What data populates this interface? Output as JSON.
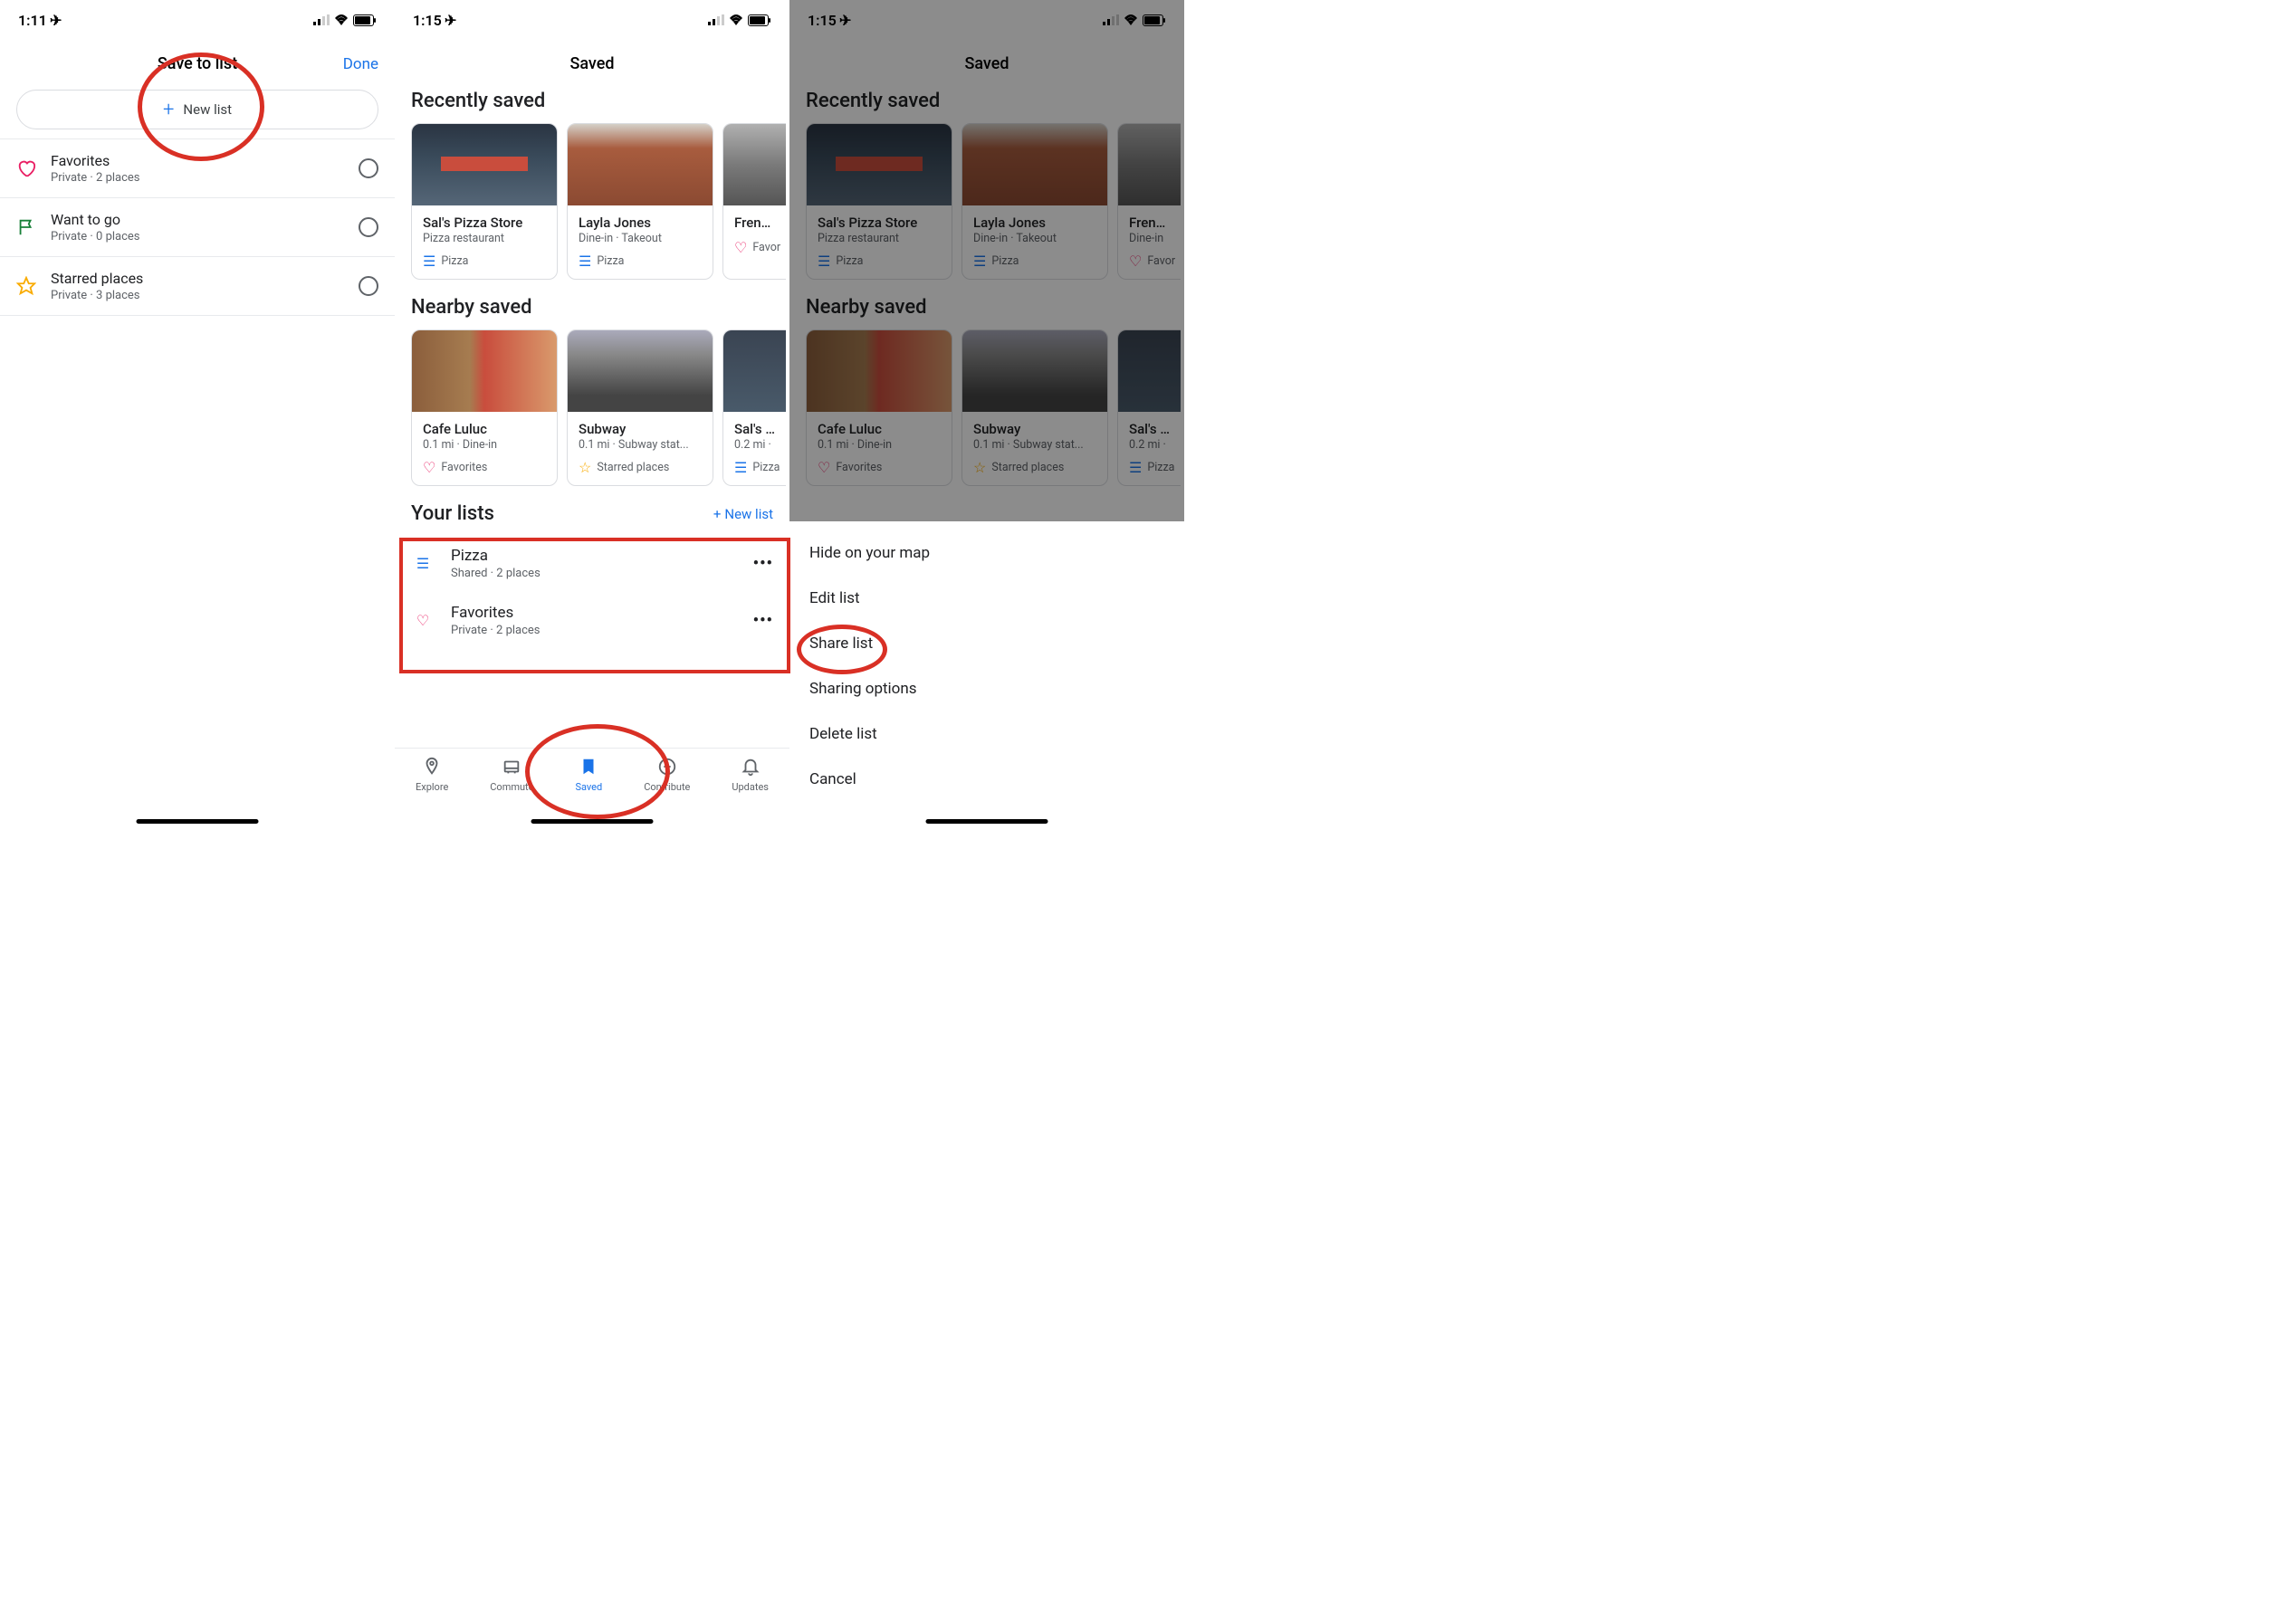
{
  "screen1": {
    "time": "1:11",
    "title": "Save to list",
    "done": "Done",
    "newlist": "New list",
    "rows": [
      {
        "name": "Favorites",
        "sub": "Private · 2 places"
      },
      {
        "name": "Want to go",
        "sub": "Private · 0 places"
      },
      {
        "name": "Starred places",
        "sub": "Private · 3 places"
      }
    ]
  },
  "screen2": {
    "time": "1:15",
    "title": "Saved",
    "sections": {
      "recent": "Recently saved",
      "nearby": "Nearby saved",
      "yourlists": "Your lists"
    },
    "newlist": "New list",
    "recent": [
      {
        "name": "Sal's Pizza Store",
        "sub": "Pizza restaurant",
        "tag": "Pizza"
      },
      {
        "name": "Layla Jones",
        "sub": "Dine-in · Takeout",
        "tag": "Pizza"
      },
      {
        "name": "French",
        "sub": "",
        "tag": "Favor"
      }
    ],
    "nearby": [
      {
        "name": "Cafe Luluc",
        "sub": "0.1 mi · Dine-in",
        "tag": "Favorites"
      },
      {
        "name": "Subway",
        "sub": "0.1 mi · Subway stat...",
        "tag": "Starred places"
      },
      {
        "name": "Sal's Pi",
        "sub": "0.2 mi ·",
        "tag": "Pizza"
      }
    ],
    "lists": [
      {
        "name": "Pizza",
        "sub": "Shared · 2 places"
      },
      {
        "name": "Favorites",
        "sub": "Private · 2 places"
      }
    ],
    "tabs": [
      "Explore",
      "Commute",
      "Saved",
      "Contribute",
      "Updates"
    ]
  },
  "screen3": {
    "time": "1:15",
    "title": "Saved",
    "sections": {
      "recent": "Recently saved",
      "nearby": "Nearby saved"
    },
    "recent": [
      {
        "name": "Sal's Pizza Store",
        "sub": "Pizza restaurant",
        "tag": "Pizza"
      },
      {
        "name": "Layla Jones",
        "sub": "Dine-in · Takeout",
        "tag": "Pizza"
      },
      {
        "name": "French",
        "sub": "Dine-in",
        "tag": "Favor"
      }
    ],
    "nearby": [
      {
        "name": "Cafe Luluc",
        "sub": "0.1 mi · Dine-in",
        "tag": "Favorites"
      },
      {
        "name": "Subway",
        "sub": "0.1 mi · Subway stat...",
        "tag": "Starred places"
      },
      {
        "name": "Sal's Pi",
        "sub": "0.2 mi ·",
        "tag": "Pizza"
      }
    ],
    "actions": [
      "Hide on your map",
      "Edit list",
      "Share list",
      "Sharing options",
      "Delete list",
      "Cancel"
    ]
  }
}
